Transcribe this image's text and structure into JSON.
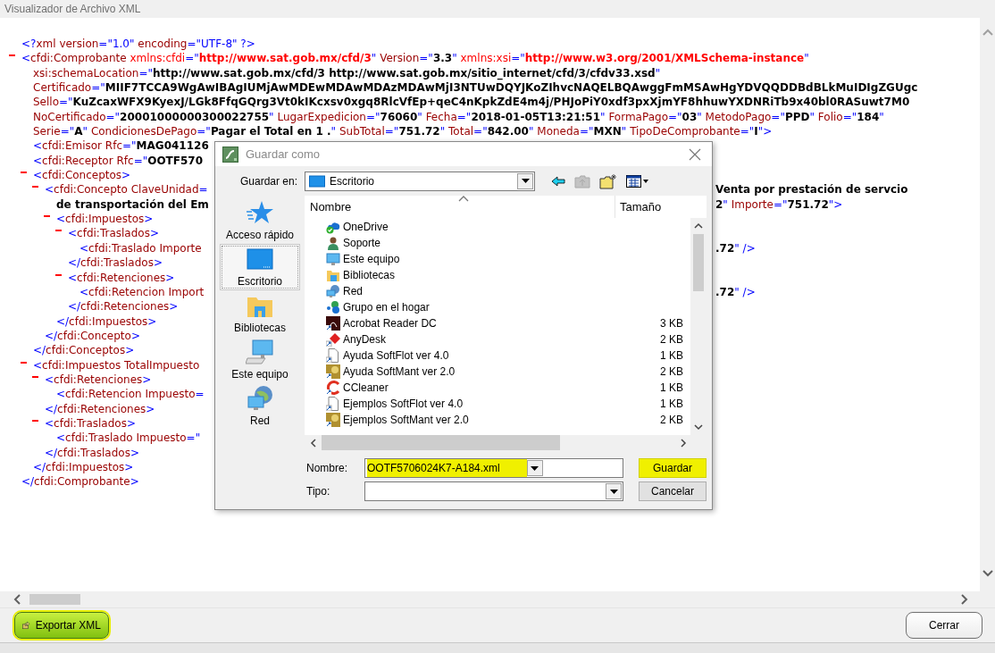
{
  "window": {
    "title": "Visualizador de Archivo XML"
  },
  "xml": [
    {
      "collapsible": false,
      "line": {
        "tokens": [
          {
            "kind": "punct",
            "text": "<?"
          },
          {
            "kind": "name",
            "text": "xml"
          },
          {
            "kind": "attr",
            "text": " version"
          },
          {
            "kind": "punct",
            "text": "=\""
          },
          {
            "kind": "punct",
            "text": "1.0"
          },
          {
            "kind": "punct",
            "text": "\""
          },
          {
            "kind": "attr",
            "text": " encoding"
          },
          {
            "kind": "punct",
            "text": "=\""
          },
          {
            "kind": "punct",
            "text": "UTF-8"
          },
          {
            "kind": "punct",
            "text": "\" ?>"
          }
        ]
      }
    },
    {
      "collapsible": true,
      "line": {
        "tokens": [
          {
            "kind": "punct",
            "text": "<"
          },
          {
            "kind": "name",
            "text": "cfdi:Comprobante"
          },
          {
            "kind": "nsattr",
            "text": " xmlns:cfdi"
          },
          {
            "kind": "punct",
            "text": "=\""
          },
          {
            "kind": "nsvalue",
            "text": "http://www.sat.gob.mx/cfd/3"
          },
          {
            "kind": "punct",
            "text": "\""
          },
          {
            "kind": "attr",
            "text": " Version"
          },
          {
            "kind": "punct",
            "text": "=\""
          },
          {
            "kind": "value",
            "text": "3.3"
          },
          {
            "kind": "punct",
            "text": "\""
          },
          {
            "kind": "nsattr",
            "text": " xmlns:xsi"
          },
          {
            "kind": "punct",
            "text": "=\""
          },
          {
            "kind": "nsvalue",
            "text": "http://www.w3.org/2001/XMLSchema-instance"
          },
          {
            "kind": "punct",
            "text": "\""
          }
        ]
      },
      "more": [
        {
          "tokens": [
            {
              "kind": "attr",
              "text": "xsi:schemaLocation"
            },
            {
              "kind": "punct",
              "text": "=\""
            },
            {
              "kind": "value",
              "text": "http://www.sat.gob.mx/cfd/3 http://www.sat.gob.mx/sitio_internet/cfd/3/cfdv33.xsd"
            },
            {
              "kind": "punct",
              "text": "\""
            }
          ]
        },
        {
          "tokens": [
            {
              "kind": "attr",
              "text": "Certificado"
            },
            {
              "kind": "punct",
              "text": "=\""
            },
            {
              "kind": "value",
              "text": "MIIF7TCCA9WgAwIBAgIUMjAwMDEwMDAwMDAzMDAwMjI3NTUwDQYJKoZIhvcNAQELBQAwggFmMSAwHgYDVQQDDBdBLkMuIDIgZGUgc"
            }
          ]
        },
        {
          "tokens": [
            {
              "kind": "attr",
              "text": "Sello"
            },
            {
              "kind": "punct",
              "text": "=\""
            },
            {
              "kind": "value",
              "text": "KuZcaxWFX9KyexJ/LGk8FfqGQrg3Vt0kIKcxsv0xgq8RlcVfEp+qeC4nKpkZdE4m4j/PHJoPiY0xdf3pxXjmYF8hhuwYXDNRiTb9x40bl0RASuwt7M0"
            }
          ]
        },
        {
          "tokens": [
            {
              "kind": "attr",
              "text": "NoCertificado"
            },
            {
              "kind": "punct",
              "text": "=\""
            },
            {
              "kind": "value",
              "text": "20001000000300022755"
            },
            {
              "kind": "punct",
              "text": "\""
            },
            {
              "kind": "attr",
              "text": " LugarExpedicion"
            },
            {
              "kind": "punct",
              "text": "=\""
            },
            {
              "kind": "value",
              "text": "76060"
            },
            {
              "kind": "punct",
              "text": "\""
            },
            {
              "kind": "attr",
              "text": " Fecha"
            },
            {
              "kind": "punct",
              "text": "=\""
            },
            {
              "kind": "value",
              "text": "2018-01-05T13:21:51"
            },
            {
              "kind": "punct",
              "text": "\""
            },
            {
              "kind": "attr",
              "text": " FormaPago"
            },
            {
              "kind": "punct",
              "text": "=\""
            },
            {
              "kind": "value",
              "text": "03"
            },
            {
              "kind": "punct",
              "text": "\""
            },
            {
              "kind": "attr",
              "text": " MetodoPago"
            },
            {
              "kind": "punct",
              "text": "=\""
            },
            {
              "kind": "value",
              "text": "PPD"
            },
            {
              "kind": "punct",
              "text": "\""
            },
            {
              "kind": "attr",
              "text": " Folio"
            },
            {
              "kind": "punct",
              "text": "=\""
            },
            {
              "kind": "value",
              "text": "184"
            },
            {
              "kind": "punct",
              "text": "\""
            }
          ]
        },
        {
          "tokens": [
            {
              "kind": "attr",
              "text": "Serie"
            },
            {
              "kind": "punct",
              "text": "=\""
            },
            {
              "kind": "value",
              "text": "A"
            },
            {
              "kind": "punct",
              "text": "\""
            },
            {
              "kind": "attr",
              "text": " CondicionesDePago"
            },
            {
              "kind": "punct",
              "text": "=\""
            },
            {
              "kind": "value",
              "text": "Pagar el Total en 1 ."
            },
            {
              "kind": "punct",
              "text": "\""
            },
            {
              "kind": "attr",
              "text": " SubTotal"
            },
            {
              "kind": "punct",
              "text": "=\""
            },
            {
              "kind": "value",
              "text": "751.72"
            },
            {
              "kind": "punct",
              "text": "\""
            },
            {
              "kind": "attr",
              "text": " Total"
            },
            {
              "kind": "punct",
              "text": "=\""
            },
            {
              "kind": "value",
              "text": "842.00"
            },
            {
              "kind": "punct",
              "text": "\""
            },
            {
              "kind": "attr",
              "text": " Moneda"
            },
            {
              "kind": "punct",
              "text": "=\""
            },
            {
              "kind": "value",
              "text": "MXN"
            },
            {
              "kind": "punct",
              "text": "\""
            },
            {
              "kind": "attr",
              "text": " TipoDeComprobante"
            },
            {
              "kind": "punct",
              "text": "=\""
            },
            {
              "kind": "value",
              "text": "I"
            },
            {
              "kind": "punct",
              "text": "\">"
            }
          ]
        }
      ],
      "children": [
        {
          "collapsible": false,
          "line": {
            "tokens": [
              {
                "kind": "punct",
                "text": "<"
              },
              {
                "kind": "name",
                "text": "cfdi:Emisor"
              },
              {
                "kind": "attr",
                "text": " Rfc"
              },
              {
                "kind": "punct",
                "text": "=\""
              },
              {
                "kind": "value",
                "text": "MAG041126"
              }
            ]
          }
        },
        {
          "collapsible": false,
          "line": {
            "tokens": [
              {
                "kind": "punct",
                "text": "<"
              },
              {
                "kind": "name",
                "text": "cfdi:Receptor"
              },
              {
                "kind": "attr",
                "text": " Rfc"
              },
              {
                "kind": "punct",
                "text": "=\""
              },
              {
                "kind": "value",
                "text": "OOTF570"
              }
            ]
          }
        },
        {
          "collapsible": true,
          "line": {
            "tokens": [
              {
                "kind": "punct",
                "text": "<"
              },
              {
                "kind": "name",
                "text": "cfdi:Conceptos"
              },
              {
                "kind": "punct",
                "text": ">"
              }
            ]
          },
          "children": [
            {
              "collapsible": true,
              "line": {
                "tokens": [
                  {
                    "kind": "punct",
                    "text": "<"
                  },
                  {
                    "kind": "name",
                    "text": "cfdi:Concepto"
                  },
                  {
                    "kind": "attr",
                    "text": " ClaveUnidad"
                  },
                  {
                    "kind": "punct",
                    "text": "="
                  }
                ],
                "right": [
                  {
                    "kind": "value",
                    "text": "Venta por prestación de servcio"
                  }
                ]
              },
              "more": [
                {
                  "tokens": [
                    {
                      "kind": "value",
                      "text": "de transportación del Em"
                    }
                  ],
                  "right": [
                    {
                      "kind": "value",
                      "text": "2"
                    },
                    {
                      "kind": "punct",
                      "text": "\""
                    },
                    {
                      "kind": "attr",
                      "text": " Importe"
                    },
                    {
                      "kind": "punct",
                      "text": "=\""
                    },
                    {
                      "kind": "value",
                      "text": "751.72"
                    },
                    {
                      "kind": "punct",
                      "text": "\">"
                    }
                  ]
                }
              ],
              "children": [
                {
                  "collapsible": true,
                  "line": {
                    "tokens": [
                      {
                        "kind": "punct",
                        "text": "<"
                      },
                      {
                        "kind": "name",
                        "text": "cfdi:Impuestos"
                      },
                      {
                        "kind": "punct",
                        "text": ">"
                      }
                    ]
                  },
                  "children": [
                    {
                      "collapsible": true,
                      "line": {
                        "tokens": [
                          {
                            "kind": "punct",
                            "text": "<"
                          },
                          {
                            "kind": "name",
                            "text": "cfdi:Traslados"
                          },
                          {
                            "kind": "punct",
                            "text": ">"
                          }
                        ]
                      },
                      "children": [
                        {
                          "collapsible": false,
                          "line": {
                            "tokens": [
                              {
                                "kind": "punct",
                                "text": "<"
                              },
                              {
                                "kind": "name",
                                "text": "cfdi:Traslado"
                              },
                              {
                                "kind": "attr",
                                "text": " Importe"
                              }
                            ],
                            "right": [
                              {
                                "kind": "value",
                                "text": ".72"
                              },
                              {
                                "kind": "punct",
                                "text": "\" />"
                              }
                            ]
                          }
                        }
                      ],
                      "close": [
                        {
                          "kind": "punct",
                          "text": "</"
                        },
                        {
                          "kind": "name",
                          "text": "cfdi:Traslados"
                        },
                        {
                          "kind": "punct",
                          "text": ">"
                        }
                      ]
                    },
                    {
                      "collapsible": true,
                      "line": {
                        "tokens": [
                          {
                            "kind": "punct",
                            "text": "<"
                          },
                          {
                            "kind": "name",
                            "text": "cfdi:Retenciones"
                          },
                          {
                            "kind": "punct",
                            "text": ">"
                          }
                        ]
                      },
                      "children": [
                        {
                          "collapsible": false,
                          "line": {
                            "tokens": [
                              {
                                "kind": "punct",
                                "text": "<"
                              },
                              {
                                "kind": "name",
                                "text": "cfdi:Retencion"
                              },
                              {
                                "kind": "attr",
                                "text": " Import"
                              }
                            ],
                            "right": [
                              {
                                "kind": "value",
                                "text": ".72"
                              },
                              {
                                "kind": "punct",
                                "text": "\" />"
                              }
                            ]
                          }
                        }
                      ],
                      "close": [
                        {
                          "kind": "punct",
                          "text": "</"
                        },
                        {
                          "kind": "name",
                          "text": "cfdi:Retenciones"
                        },
                        {
                          "kind": "punct",
                          "text": ">"
                        }
                      ]
                    }
                  ],
                  "close": [
                    {
                      "kind": "punct",
                      "text": "</"
                    },
                    {
                      "kind": "name",
                      "text": "cfdi:Impuestos"
                    },
                    {
                      "kind": "punct",
                      "text": ">"
                    }
                  ]
                }
              ],
              "close": [
                {
                  "kind": "punct",
                  "text": "</"
                },
                {
                  "kind": "name",
                  "text": "cfdi:Concepto"
                },
                {
                  "kind": "punct",
                  "text": ">"
                }
              ]
            }
          ],
          "close": [
            {
              "kind": "punct",
              "text": "</"
            },
            {
              "kind": "name",
              "text": "cfdi:Conceptos"
            },
            {
              "kind": "punct",
              "text": ">"
            }
          ]
        },
        {
          "collapsible": true,
          "line": {
            "tokens": [
              {
                "kind": "punct",
                "text": "<"
              },
              {
                "kind": "name",
                "text": "cfdi:Impuestos"
              },
              {
                "kind": "attr",
                "text": " TotalImpuesto"
              }
            ]
          },
          "children": [
            {
              "collapsible": true,
              "line": {
                "tokens": [
                  {
                    "kind": "punct",
                    "text": "<"
                  },
                  {
                    "kind": "name",
                    "text": "cfdi:Retenciones"
                  },
                  {
                    "kind": "punct",
                    "text": ">"
                  }
                ]
              },
              "children": [
                {
                  "collapsible": false,
                  "line": {
                    "tokens": [
                      {
                        "kind": "punct",
                        "text": "<"
                      },
                      {
                        "kind": "name",
                        "text": "cfdi:Retencion"
                      },
                      {
                        "kind": "attr",
                        "text": " Impuesto"
                      },
                      {
                        "kind": "punct",
                        "text": "="
                      }
                    ]
                  }
                }
              ],
              "close": [
                {
                  "kind": "punct",
                  "text": "</"
                },
                {
                  "kind": "name",
                  "text": "cfdi:Retenciones"
                },
                {
                  "kind": "punct",
                  "text": ">"
                }
              ]
            },
            {
              "collapsible": true,
              "line": {
                "tokens": [
                  {
                    "kind": "punct",
                    "text": "<"
                  },
                  {
                    "kind": "name",
                    "text": "cfdi:Traslados"
                  },
                  {
                    "kind": "punct",
                    "text": ">"
                  }
                ]
              },
              "children": [
                {
                  "collapsible": false,
                  "line": {
                    "tokens": [
                      {
                        "kind": "punct",
                        "text": "<"
                      },
                      {
                        "kind": "name",
                        "text": "cfdi:Traslado"
                      },
                      {
                        "kind": "attr",
                        "text": " Impuesto"
                      },
                      {
                        "kind": "punct",
                        "text": "=\""
                      }
                    ]
                  }
                }
              ],
              "close": [
                {
                  "kind": "punct",
                  "text": "</"
                },
                {
                  "kind": "name",
                  "text": "cfdi:Traslados"
                },
                {
                  "kind": "punct",
                  "text": ">"
                }
              ]
            }
          ],
          "close": [
            {
              "kind": "punct",
              "text": "</"
            },
            {
              "kind": "name",
              "text": "cfdi:Impuestos"
            },
            {
              "kind": "punct",
              "text": ">"
            }
          ]
        }
      ],
      "close": [
        {
          "kind": "punct",
          "text": "</"
        },
        {
          "kind": "name",
          "text": "cfdi:Comprobante"
        },
        {
          "kind": "punct",
          "text": ">"
        }
      ]
    }
  ],
  "dialog": {
    "title": "Guardar como",
    "location_label": "Guardar en:",
    "location": "Escritorio",
    "toolbar": [
      {
        "disabled": false
      },
      {
        "disabled": true
      },
      {
        "disabled": false
      },
      {
        "disabled": false
      }
    ],
    "places": [
      {
        "label": "Acceso rápido",
        "selected": false
      },
      {
        "label": "Escritorio",
        "selected": true
      },
      {
        "label": "Bibliotecas",
        "selected": false
      },
      {
        "label": "Este equipo",
        "selected": false
      },
      {
        "label": "Red",
        "selected": false
      }
    ],
    "columns": [
      "Nombre",
      "Tamaño"
    ],
    "files": [
      {
        "name": "OneDrive"
      },
      {
        "name": "Soporte"
      },
      {
        "name": "Este equipo"
      },
      {
        "name": "Bibliotecas"
      },
      {
        "name": "Red"
      },
      {
        "name": "Grupo en el hogar"
      },
      {
        "name": "Acrobat Reader DC",
        "size": "3 KB"
      },
      {
        "name": "AnyDesk",
        "size": "2 KB"
      },
      {
        "name": "Ayuda SoftFlot ver 4.0",
        "size": "1 KB"
      },
      {
        "name": "Ayuda SoftMant ver 2.0",
        "size": "2 KB"
      },
      {
        "name": "CCleaner",
        "size": "1 KB"
      },
      {
        "name": "Ejemplos SoftFlot ver 4.0",
        "size": "1 KB"
      },
      {
        "name": "Ejemplos SoftMant ver 2.0",
        "size": "2 KB"
      }
    ],
    "filename_label": "Nombre:",
    "filename": {
      "value": "OOTF5706024K7-A184.xml",
      "highlighted": true
    },
    "type_label": "Tipo:",
    "buttons": [
      {
        "label": "Guardar",
        "highlighted": true
      },
      {
        "label": "Cancelar",
        "highlighted": false
      }
    ]
  },
  "footer_buttons": [
    {
      "kind": "export",
      "label": "Exportar XML",
      "highlighted": true
    },
    {
      "kind": "close",
      "label": "Cerrar",
      "highlighted": false
    }
  ]
}
